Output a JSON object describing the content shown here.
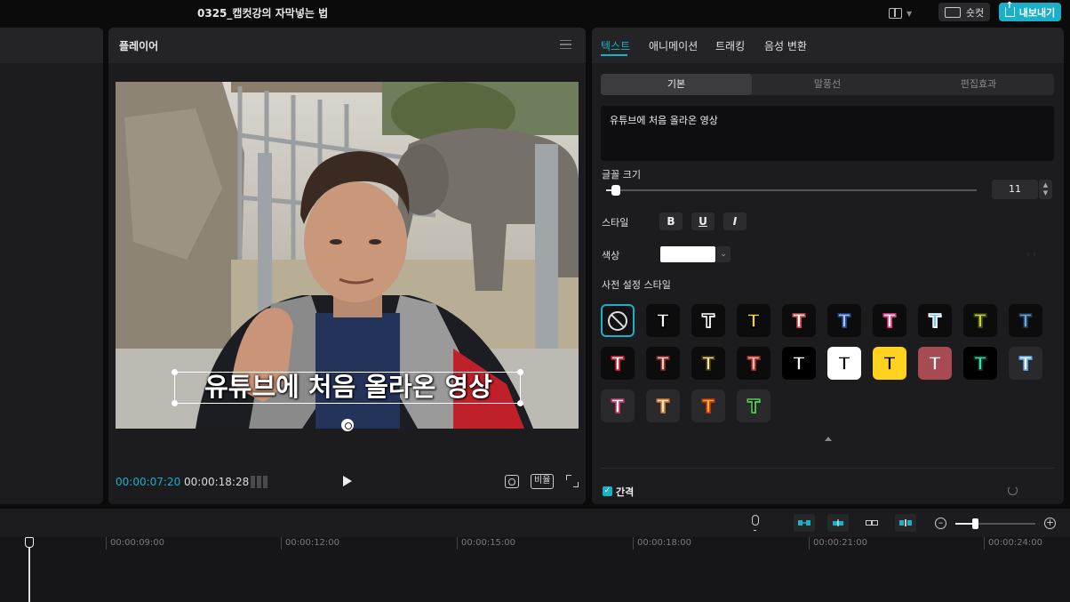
{
  "app": {
    "project_title": "0325_캡컷강의 자막넣는 법",
    "shortcut_label": "숏컷",
    "export_label": "내보내기"
  },
  "colors": {
    "accent": "#1ab0c8",
    "panel": "#1c1c1e",
    "background": "#0b0b0c"
  },
  "player": {
    "title": "플레이어",
    "subtitle_text": "유튜브에 처음 올라온 영상",
    "current_time": "00:00:07:20",
    "total_time": "00:00:18:28",
    "ratio_label": "비율"
  },
  "inspector": {
    "tabs": [
      "텍스트",
      "애니메이션",
      "트래킹",
      "음성 변환"
    ],
    "subtabs": [
      "기본",
      "말풍선",
      "편집효과"
    ],
    "text_value": "유튜브에 처음 올라온 영상",
    "font_size_label": "글꼴 크기",
    "font_size_value": "11",
    "font_size_fraction": 0.02,
    "style_label": "스타일",
    "style_buttons": [
      "B",
      "U",
      "I"
    ],
    "color_label": "색상",
    "color_value": "#ffffff",
    "preset_label": "사전 설정 스타일",
    "spacing_label": "간격",
    "presets": [
      {
        "name": "none"
      },
      {
        "fill": "#ffffff",
        "stroke": "#000000",
        "bg": "#0c0c0d"
      },
      {
        "fill": "#0c0c0d",
        "stroke": "#ffffff",
        "bg": "#0c0c0d"
      },
      {
        "fill": "#ffd21f",
        "stroke": "#000000",
        "bg": "#0c0c0d"
      },
      {
        "fill": "#ffffff",
        "stroke": "#e04a4a",
        "bg": "#0c0c0d"
      },
      {
        "fill": "#9cc9ff",
        "stroke": "#2a4a8a",
        "bg": "#0c0c0d"
      },
      {
        "fill": "#ffffff",
        "stroke": "#ff3c8c",
        "bg": "#0c0c0d"
      },
      {
        "fill": "#6cc8ff",
        "stroke": "#ffffff",
        "bg": "#0c0c0d"
      },
      {
        "fill": "#c9d440",
        "stroke": "#3a4a10",
        "bg": "#0c0c0d"
      },
      {
        "fill": "#6fa8d8",
        "stroke": "#223a5a",
        "bg": "#0c0c0d"
      },
      {
        "fill": "#ffffff",
        "stroke": "#e0203a",
        "bg": "#0c0c0d"
      },
      {
        "fill": "#e8d2c8",
        "stroke": "#8a2a2a",
        "bg": "#0c0c0d"
      },
      {
        "fill": "#f0e6b0",
        "stroke": "#4a3a10",
        "bg": "#0c0c0d"
      },
      {
        "fill": "#ffb0a0",
        "stroke": "#a03a2a",
        "bg": "#0c0c0d"
      },
      {
        "fill": "#ffffff",
        "stroke": "#000000",
        "bg": "#000000"
      },
      {
        "fill": "#000000",
        "stroke": "#ffffff",
        "bg": "#ffffff"
      },
      {
        "fill": "#000000",
        "stroke": "#ffd21f",
        "bg": "#ffd21f"
      },
      {
        "fill": "#ffffff",
        "stroke": "#a84a52",
        "bg": "#a84a52"
      },
      {
        "fill": "#40e0a0",
        "stroke": "#0c3a2a",
        "bg": "#000000"
      },
      {
        "fill": "#ffffff",
        "stroke": "#5aa8ff",
        "bg": "#2a2a2d"
      },
      {
        "fill": "#ffffff",
        "stroke": "#d03a6a",
        "bg": "#2a2a2d"
      },
      {
        "fill": "#ffe8c0",
        "stroke": "#c87a3a",
        "bg": "#2a2a2d"
      },
      {
        "fill": "#ffb020",
        "stroke": "#c03a10",
        "bg": "#2a2a2d"
      },
      {
        "fill": "#000000",
        "stroke": "#40e040",
        "bg": "#2a2a2d"
      }
    ]
  },
  "timeline": {
    "ruler_labels": [
      "00:00:09:00",
      "00:00:12:00",
      "00:00:15:00",
      "00:00:18:00",
      "00:00:21:00",
      "00:00:24:00"
    ],
    "zoom_fraction": 0.24
  }
}
